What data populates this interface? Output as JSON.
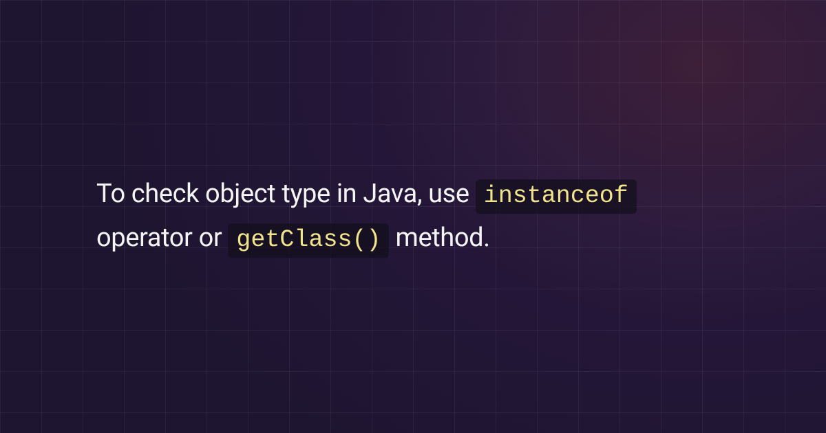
{
  "sentence": {
    "part1": "To check object type in Java, use ",
    "code1": "instanceof",
    "part2": " operator or ",
    "code2": "getClass()",
    "part3": " method."
  }
}
